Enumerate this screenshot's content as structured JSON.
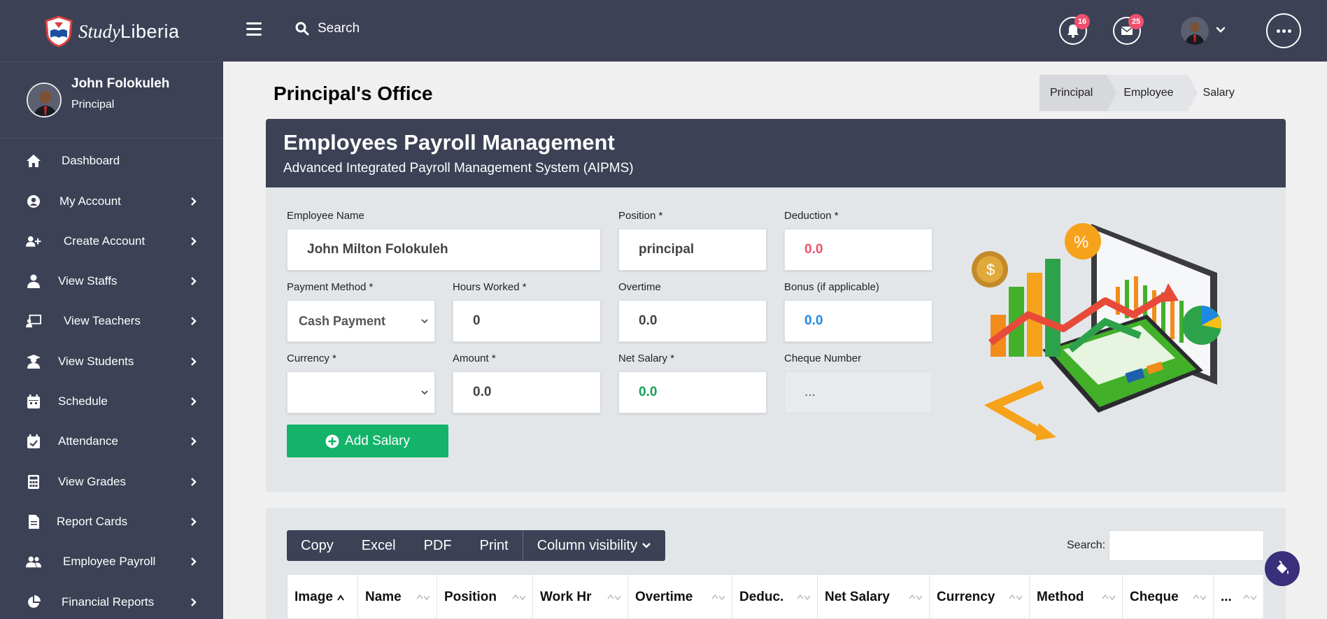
{
  "brand": {
    "script": "Study",
    "plain": "Liberia"
  },
  "topbar": {
    "search_label": "Search",
    "notifications_count": "16",
    "messages_count": "25"
  },
  "profile": {
    "name": "John Folokuleh",
    "role": "Principal"
  },
  "sidebar": {
    "items": [
      {
        "label": "Dashboard",
        "icon": "home-icon",
        "chevron": false
      },
      {
        "label": "My Account",
        "icon": "user-circle-icon",
        "chevron": true
      },
      {
        "label": "Create Account",
        "icon": "user-plus-icon",
        "chevron": true
      },
      {
        "label": "View Staffs",
        "icon": "user-tie-icon",
        "chevron": true
      },
      {
        "label": "View Teachers",
        "icon": "chalkboard-teacher-icon",
        "chevron": true
      },
      {
        "label": "View Students",
        "icon": "user-graduate-icon",
        "chevron": true
      },
      {
        "label": "Schedule",
        "icon": "calendar-icon",
        "chevron": true
      },
      {
        "label": "Attendance",
        "icon": "calendar-check-icon",
        "chevron": true
      },
      {
        "label": "View Grades",
        "icon": "calculator-icon",
        "chevron": true
      },
      {
        "label": "Report Cards",
        "icon": "file-icon",
        "chevron": true
      },
      {
        "label": "Employee Payroll",
        "icon": "users-icon",
        "chevron": true
      },
      {
        "label": "Financial Reports",
        "icon": "chart-pie-icon",
        "chevron": true
      }
    ]
  },
  "page": {
    "title": "Principal's Office",
    "breadcrumb": [
      "Principal",
      "Employee",
      "Salary"
    ]
  },
  "panel": {
    "title": "Employees Payroll Management",
    "subtitle": "Advanced Integrated Payroll Management System (AIPMS)"
  },
  "form": {
    "employee_name": {
      "label": "Employee Name",
      "value": "John Milton Folokuleh"
    },
    "position": {
      "label": "Position *",
      "value": "principal"
    },
    "deduction": {
      "label": "Deduction *",
      "value": "0.0"
    },
    "payment_method": {
      "label": "Payment Method *",
      "value": "Cash Payment"
    },
    "hours_worked": {
      "label": "Hours Worked *",
      "value": "0"
    },
    "overtime": {
      "label": "Overtime",
      "value": "0.0"
    },
    "bonus": {
      "label": "Bonus (if applicable)",
      "value": "0.0"
    },
    "currency": {
      "label": "Currency *",
      "value": ""
    },
    "amount": {
      "label": "Amount *",
      "value": "0.0"
    },
    "net_salary": {
      "label": "Net Salary *",
      "value": "0.0"
    },
    "cheque_number": {
      "label": "Cheque Number",
      "value": "..."
    },
    "add_button": "Add Salary"
  },
  "table": {
    "buttons": [
      "Copy",
      "Excel",
      "PDF",
      "Print"
    ],
    "column_visibility": "Column visibility",
    "search_label": "Search:",
    "columns": [
      "Image",
      "Name",
      "Position",
      "Work Hr",
      "Overtime",
      "Deduc.",
      "Net Salary",
      "Currency",
      "Method",
      "Cheque",
      "..."
    ]
  },
  "colors": {
    "dark": "#3c4155",
    "green": "#13b36a",
    "red": "#f0506e",
    "blue": "#1e88e5"
  }
}
